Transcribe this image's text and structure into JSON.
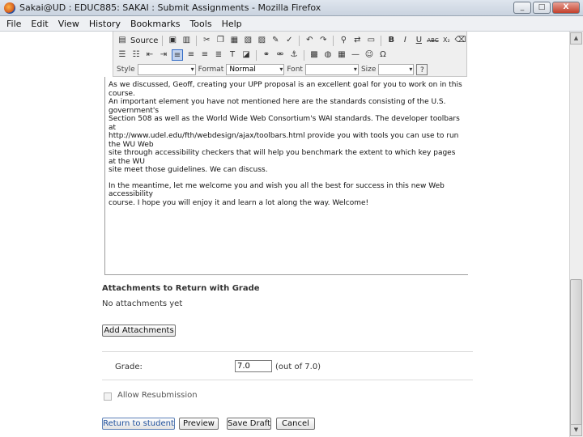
{
  "window": {
    "title": "Sakai@UD : EDUC885: SAKAI : Submit Assignments - Mozilla Firefox",
    "minimize": "_",
    "maximize": "□",
    "close": "X"
  },
  "menu": [
    "File",
    "Edit",
    "View",
    "History",
    "Bookmarks",
    "Tools",
    "Help"
  ],
  "toolbar": {
    "source_label": "Source",
    "style_label": "Style",
    "format_label": "Format",
    "format_value": "Normal",
    "font_label": "Font",
    "size_label": "Size",
    "bold": "B",
    "italic": "I",
    "underline": "U",
    "strike": "ABC",
    "subscript": "X₂",
    "help": "?"
  },
  "editor": {
    "paragraph1": "As we discussed, Geoff, creating your UPP proposal is an excellent goal for you to work on in this course.\nAn important element you have not mentioned here are the standards consisting of the U.S. government's\nSection 508 as well as the World Wide Web Consortium's WAI standards. The developer toolbars at\nhttp://www.udel.edu/fth/webdesign/ajax/toolbars.html provide you with tools you can use to run the WU Web\nsite through accessibility checkers that will help you benchmark the extent to which key pages at the WU\nsite meet those guidelines. We can discuss.",
    "paragraph2": "In the meantime, let me welcome you and wish you all the best for success in this new Web accessibility\ncourse. I hope you will enjoy it and learn a lot along the way. Welcome!"
  },
  "attachments": {
    "heading": "Attachments to Return with Grade",
    "empty_text": "No attachments yet",
    "add_button": "Add Attachments"
  },
  "grade": {
    "label": "Grade:",
    "value": "7.0",
    "out_of": "(out of 7.0)"
  },
  "resubmission": {
    "label": "Allow Resubmission",
    "checked": false
  },
  "actions": {
    "return_button": "Return to student",
    "preview_button": "Preview",
    "save_draft_button": "Save Draft",
    "cancel_button": "Cancel"
  }
}
